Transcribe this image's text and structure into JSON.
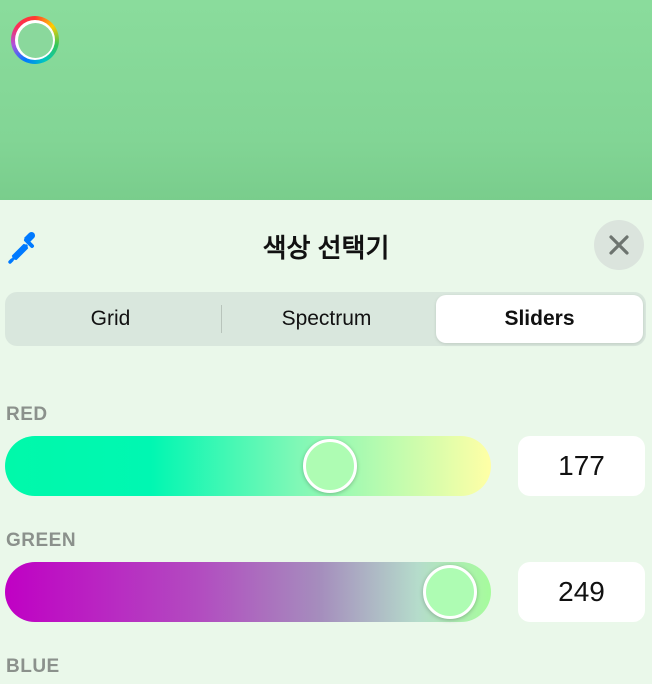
{
  "window": {
    "title": "색상 선택기"
  },
  "segmented_control": {
    "tabs": [
      {
        "label": "Grid",
        "selected": false
      },
      {
        "label": "Spectrum",
        "selected": false
      },
      {
        "label": "Sliders",
        "selected": true
      }
    ]
  },
  "sliders": {
    "red": {
      "label": "RED",
      "value": "177"
    },
    "green": {
      "label": "GREEN",
      "value": "249"
    },
    "blue": {
      "label": "BLUE"
    }
  },
  "colors": {
    "selected_color": "#8AD89C",
    "accent": "#007AFF"
  },
  "icons": {
    "eyedropper": "eyedropper-icon",
    "close": "close-icon",
    "color_well": "color-well-icon"
  }
}
